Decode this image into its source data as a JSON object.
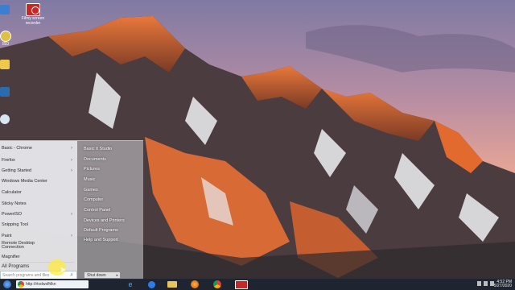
{
  "desktop": {
    "icons": [
      {
        "name": "recorder-icon",
        "label": "Filmy screen recorder"
      },
      {
        "name": "iso-icon",
        "label": "ISO"
      }
    ]
  },
  "start_menu": {
    "programs": [
      {
        "label": "Basic - Chrome",
        "arrow": "›"
      },
      {
        "label": "Firefox",
        "arrow": "›"
      },
      {
        "label": "Getting Started",
        "arrow": "›"
      },
      {
        "label": "Windows Media Center",
        "arrow": ""
      },
      {
        "label": "Calculator",
        "arrow": ""
      },
      {
        "label": "Sticky Notes",
        "arrow": ""
      },
      {
        "label": "PowerISO",
        "arrow": "›"
      },
      {
        "label": "Snipping Tool",
        "arrow": ""
      },
      {
        "label": "Paint",
        "arrow": "›"
      },
      {
        "label": "Remote Desktop Connection",
        "arrow": ""
      },
      {
        "label": "Magnifier",
        "arrow": ""
      }
    ],
    "all_programs": "All Programs",
    "search_placeholder": "Search programs and files",
    "right_items": [
      "Basic It Studio",
      "Documents",
      "Pictures",
      "Music",
      "Games",
      "Computer",
      "Control Panel",
      "Devices and Printers",
      "Default Programs",
      "Help and Support"
    ],
    "shutdown_label": "Shut down",
    "shutdown_caret": "▸"
  },
  "taskbar": {
    "url_text": "http://rtvdwsfhlkn",
    "time": "4:52 PM",
    "date": "5/27/2020"
  },
  "colors": {
    "taskbar": "#1c2430",
    "start_pane": "#ebebee",
    "recorder_red": "#c62828"
  }
}
